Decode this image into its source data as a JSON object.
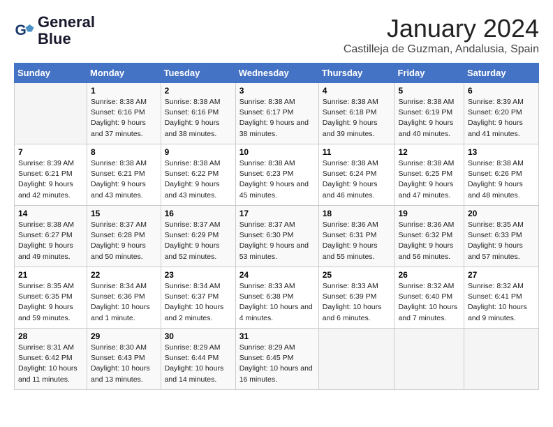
{
  "logo": {
    "line1": "General",
    "line2": "Blue"
  },
  "title": "January 2024",
  "subtitle": "Castilleja de Guzman, Andalusia, Spain",
  "days_of_week": [
    "Sunday",
    "Monday",
    "Tuesday",
    "Wednesday",
    "Thursday",
    "Friday",
    "Saturday"
  ],
  "weeks": [
    [
      {
        "num": "",
        "sunrise": "",
        "sunset": "",
        "daylight": ""
      },
      {
        "num": "1",
        "sunrise": "Sunrise: 8:38 AM",
        "sunset": "Sunset: 6:16 PM",
        "daylight": "Daylight: 9 hours and 37 minutes."
      },
      {
        "num": "2",
        "sunrise": "Sunrise: 8:38 AM",
        "sunset": "Sunset: 6:16 PM",
        "daylight": "Daylight: 9 hours and 38 minutes."
      },
      {
        "num": "3",
        "sunrise": "Sunrise: 8:38 AM",
        "sunset": "Sunset: 6:17 PM",
        "daylight": "Daylight: 9 hours and 38 minutes."
      },
      {
        "num": "4",
        "sunrise": "Sunrise: 8:38 AM",
        "sunset": "Sunset: 6:18 PM",
        "daylight": "Daylight: 9 hours and 39 minutes."
      },
      {
        "num": "5",
        "sunrise": "Sunrise: 8:38 AM",
        "sunset": "Sunset: 6:19 PM",
        "daylight": "Daylight: 9 hours and 40 minutes."
      },
      {
        "num": "6",
        "sunrise": "Sunrise: 8:39 AM",
        "sunset": "Sunset: 6:20 PM",
        "daylight": "Daylight: 9 hours and 41 minutes."
      }
    ],
    [
      {
        "num": "7",
        "sunrise": "Sunrise: 8:39 AM",
        "sunset": "Sunset: 6:21 PM",
        "daylight": "Daylight: 9 hours and 42 minutes."
      },
      {
        "num": "8",
        "sunrise": "Sunrise: 8:38 AM",
        "sunset": "Sunset: 6:21 PM",
        "daylight": "Daylight: 9 hours and 43 minutes."
      },
      {
        "num": "9",
        "sunrise": "Sunrise: 8:38 AM",
        "sunset": "Sunset: 6:22 PM",
        "daylight": "Daylight: 9 hours and 43 minutes."
      },
      {
        "num": "10",
        "sunrise": "Sunrise: 8:38 AM",
        "sunset": "Sunset: 6:23 PM",
        "daylight": "Daylight: 9 hours and 45 minutes."
      },
      {
        "num": "11",
        "sunrise": "Sunrise: 8:38 AM",
        "sunset": "Sunset: 6:24 PM",
        "daylight": "Daylight: 9 hours and 46 minutes."
      },
      {
        "num": "12",
        "sunrise": "Sunrise: 8:38 AM",
        "sunset": "Sunset: 6:25 PM",
        "daylight": "Daylight: 9 hours and 47 minutes."
      },
      {
        "num": "13",
        "sunrise": "Sunrise: 8:38 AM",
        "sunset": "Sunset: 6:26 PM",
        "daylight": "Daylight: 9 hours and 48 minutes."
      }
    ],
    [
      {
        "num": "14",
        "sunrise": "Sunrise: 8:38 AM",
        "sunset": "Sunset: 6:27 PM",
        "daylight": "Daylight: 9 hours and 49 minutes."
      },
      {
        "num": "15",
        "sunrise": "Sunrise: 8:37 AM",
        "sunset": "Sunset: 6:28 PM",
        "daylight": "Daylight: 9 hours and 50 minutes."
      },
      {
        "num": "16",
        "sunrise": "Sunrise: 8:37 AM",
        "sunset": "Sunset: 6:29 PM",
        "daylight": "Daylight: 9 hours and 52 minutes."
      },
      {
        "num": "17",
        "sunrise": "Sunrise: 8:37 AM",
        "sunset": "Sunset: 6:30 PM",
        "daylight": "Daylight: 9 hours and 53 minutes."
      },
      {
        "num": "18",
        "sunrise": "Sunrise: 8:36 AM",
        "sunset": "Sunset: 6:31 PM",
        "daylight": "Daylight: 9 hours and 55 minutes."
      },
      {
        "num": "19",
        "sunrise": "Sunrise: 8:36 AM",
        "sunset": "Sunset: 6:32 PM",
        "daylight": "Daylight: 9 hours and 56 minutes."
      },
      {
        "num": "20",
        "sunrise": "Sunrise: 8:35 AM",
        "sunset": "Sunset: 6:33 PM",
        "daylight": "Daylight: 9 hours and 57 minutes."
      }
    ],
    [
      {
        "num": "21",
        "sunrise": "Sunrise: 8:35 AM",
        "sunset": "Sunset: 6:35 PM",
        "daylight": "Daylight: 9 hours and 59 minutes."
      },
      {
        "num": "22",
        "sunrise": "Sunrise: 8:34 AM",
        "sunset": "Sunset: 6:36 PM",
        "daylight": "Daylight: 10 hours and 1 minute."
      },
      {
        "num": "23",
        "sunrise": "Sunrise: 8:34 AM",
        "sunset": "Sunset: 6:37 PM",
        "daylight": "Daylight: 10 hours and 2 minutes."
      },
      {
        "num": "24",
        "sunrise": "Sunrise: 8:33 AM",
        "sunset": "Sunset: 6:38 PM",
        "daylight": "Daylight: 10 hours and 4 minutes."
      },
      {
        "num": "25",
        "sunrise": "Sunrise: 8:33 AM",
        "sunset": "Sunset: 6:39 PM",
        "daylight": "Daylight: 10 hours and 6 minutes."
      },
      {
        "num": "26",
        "sunrise": "Sunrise: 8:32 AM",
        "sunset": "Sunset: 6:40 PM",
        "daylight": "Daylight: 10 hours and 7 minutes."
      },
      {
        "num": "27",
        "sunrise": "Sunrise: 8:32 AM",
        "sunset": "Sunset: 6:41 PM",
        "daylight": "Daylight: 10 hours and 9 minutes."
      }
    ],
    [
      {
        "num": "28",
        "sunrise": "Sunrise: 8:31 AM",
        "sunset": "Sunset: 6:42 PM",
        "daylight": "Daylight: 10 hours and 11 minutes."
      },
      {
        "num": "29",
        "sunrise": "Sunrise: 8:30 AM",
        "sunset": "Sunset: 6:43 PM",
        "daylight": "Daylight: 10 hours and 13 minutes."
      },
      {
        "num": "30",
        "sunrise": "Sunrise: 8:29 AM",
        "sunset": "Sunset: 6:44 PM",
        "daylight": "Daylight: 10 hours and 14 minutes."
      },
      {
        "num": "31",
        "sunrise": "Sunrise: 8:29 AM",
        "sunset": "Sunset: 6:45 PM",
        "daylight": "Daylight: 10 hours and 16 minutes."
      },
      {
        "num": "",
        "sunrise": "",
        "sunset": "",
        "daylight": ""
      },
      {
        "num": "",
        "sunrise": "",
        "sunset": "",
        "daylight": ""
      },
      {
        "num": "",
        "sunrise": "",
        "sunset": "",
        "daylight": ""
      }
    ]
  ]
}
